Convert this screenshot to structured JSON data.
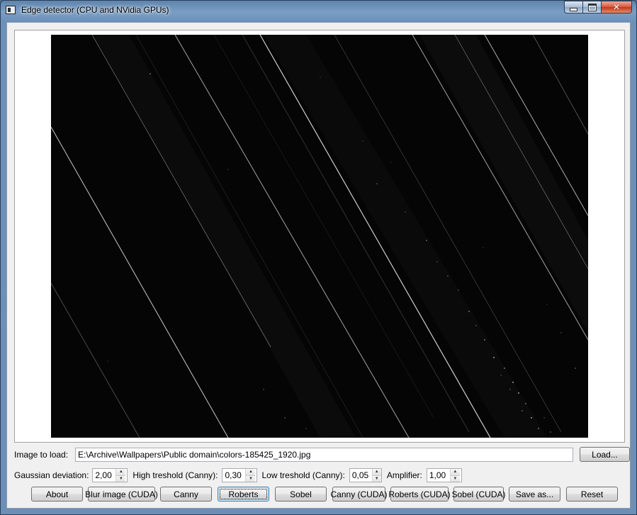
{
  "window": {
    "title": "Edge detector (CPU and NVidia GPUs)",
    "minimize_icon": "minimize-icon",
    "maximize_icon": "maximize-icon",
    "close_icon": "close-icon"
  },
  "image": {
    "description": "edge-detected image"
  },
  "load_row": {
    "label": "Image to load:",
    "path_value": "E:\\Archive\\Wallpapers\\Public domain\\colors-185425_1920.jpg",
    "load_button": "Load..."
  },
  "params": {
    "gaussian_label": "Gaussian deviation:",
    "gaussian_value": "2,00",
    "high_label": "High treshold (Canny):",
    "high_value": "0,30",
    "low_label": "Low treshold (Canny):",
    "low_value": "0,05",
    "amplifier_label": "Amplifier:",
    "amplifier_value": "1,00"
  },
  "buttons": {
    "about": "About",
    "blur_cuda": "Blur image (CUDA)",
    "canny": "Canny",
    "roberts": "Roberts",
    "sobel": "Sobel",
    "canny_cuda": "Canny (CUDA)",
    "roberts_cuda": "Roberts (CUDA)",
    "sobel_cuda": "Sobel (CUDA)",
    "save_as": "Save as...",
    "reset": "Reset"
  }
}
